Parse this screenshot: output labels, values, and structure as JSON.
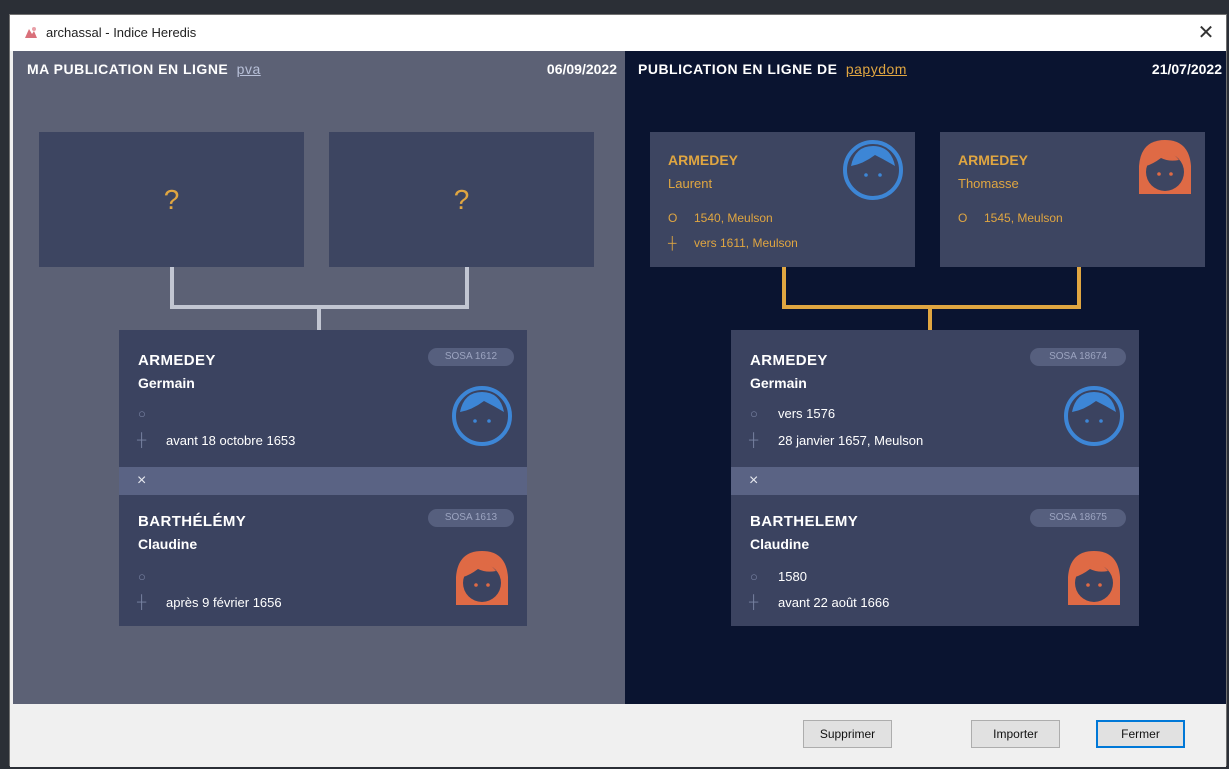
{
  "window": {
    "title": "archassal - Indice Heredis"
  },
  "left": {
    "header_prefix": "MA PUBLICATION EN LIGNE",
    "user": "pva",
    "date": "06/09/2022",
    "unknown_father": "?",
    "unknown_mother": "?",
    "husband": {
      "surname": "ARMEDEY",
      "given": "Germain",
      "sosa": "SOSA 1612",
      "birth": "",
      "death": "avant 18 octobre 1653"
    },
    "marriage_symbol": "×",
    "wife": {
      "surname": "BARTHÉLÉMY",
      "given": "Claudine",
      "sosa": "SOSA 1613",
      "birth": "",
      "death": "après 9 février 1656"
    }
  },
  "right": {
    "header_prefix": "PUBLICATION EN LIGNE DE",
    "user": "papydom",
    "date": "21/07/2022",
    "father": {
      "surname": "ARMEDEY",
      "given": "Laurent",
      "birth": "1540, Meulson",
      "death": "vers 1611, Meulson"
    },
    "mother": {
      "surname": "ARMEDEY",
      "given": "Thomasse",
      "birth": "1545, Meulson"
    },
    "husband": {
      "surname": "ARMEDEY",
      "given": "Germain",
      "sosa": "SOSA 18674",
      "birth": "vers 1576",
      "death": "28 janvier 1657, Meulson"
    },
    "marriage_symbol": "×",
    "wife": {
      "surname": "BARTHELEMY",
      "given": "Claudine",
      "sosa": "SOSA 18675",
      "birth": "1580",
      "death": "avant 22 août 1666"
    }
  },
  "buttons": {
    "delete": "Supprimer",
    "import": "Importer",
    "close": "Fermer"
  },
  "colors": {
    "male": "#3d86d6",
    "female": "#df6a45",
    "accent": "#e0a641",
    "left_bg": "#5c6175",
    "right_bg": "#0a1430"
  },
  "icons": {
    "close": "close-icon",
    "male": "male-avatar-icon",
    "female": "female-avatar-icon",
    "birth": "birth-circle-icon",
    "death": "death-cross-icon"
  }
}
